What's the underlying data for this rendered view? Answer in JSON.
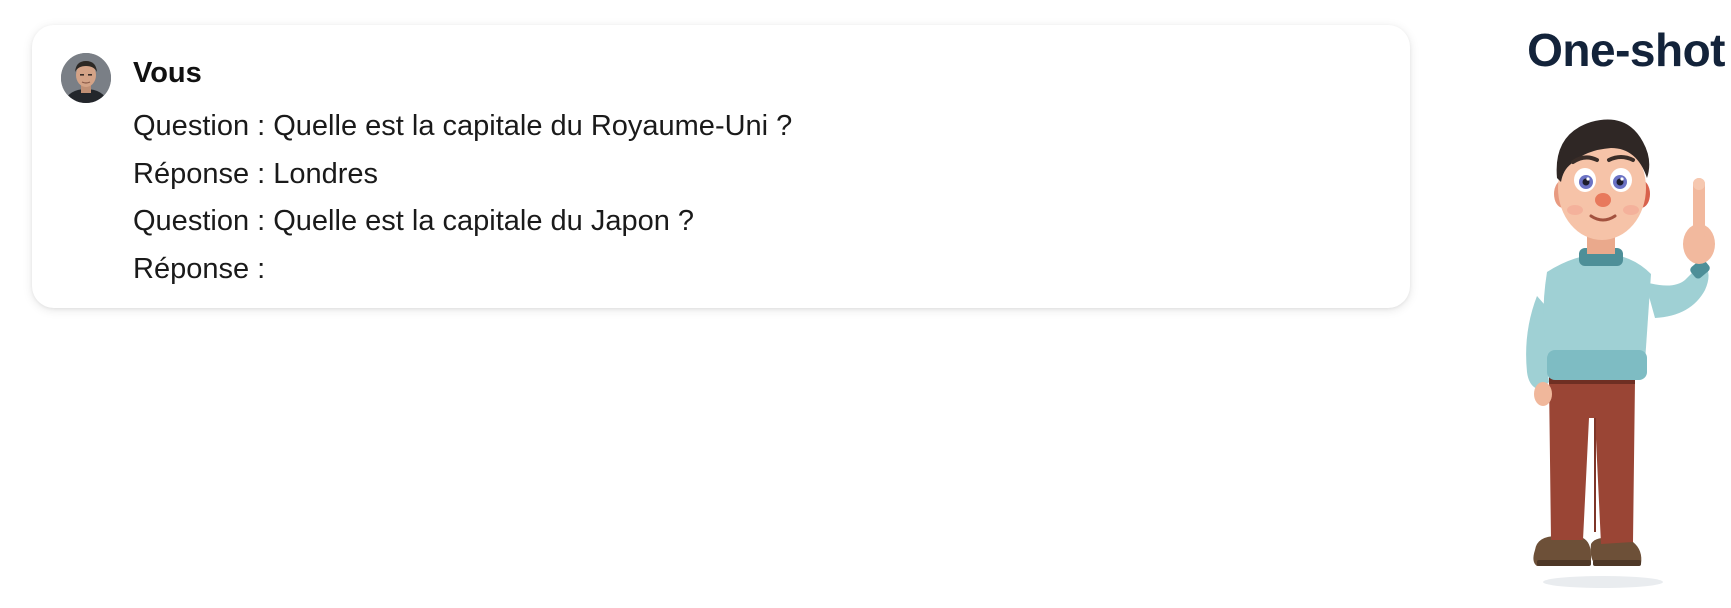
{
  "chat": {
    "sender": "Vous",
    "messages": [
      {
        "text": "Question : Quelle est la capitale du Royaume-Uni ?"
      },
      {
        "text": "Réponse : Londres"
      },
      {
        "text": "Question : Quelle est la capitale du Japon ?"
      },
      {
        "text": "Réponse :"
      }
    ]
  },
  "side_panel": {
    "title": "One-shot",
    "illustration": "cartoon-character-raising-finger"
  },
  "colors": {
    "title": "#13233a",
    "text": "#1a1a1a",
    "card_background": "#ffffff",
    "sweater": "#9fd0d4",
    "pants": "#9a4535"
  }
}
